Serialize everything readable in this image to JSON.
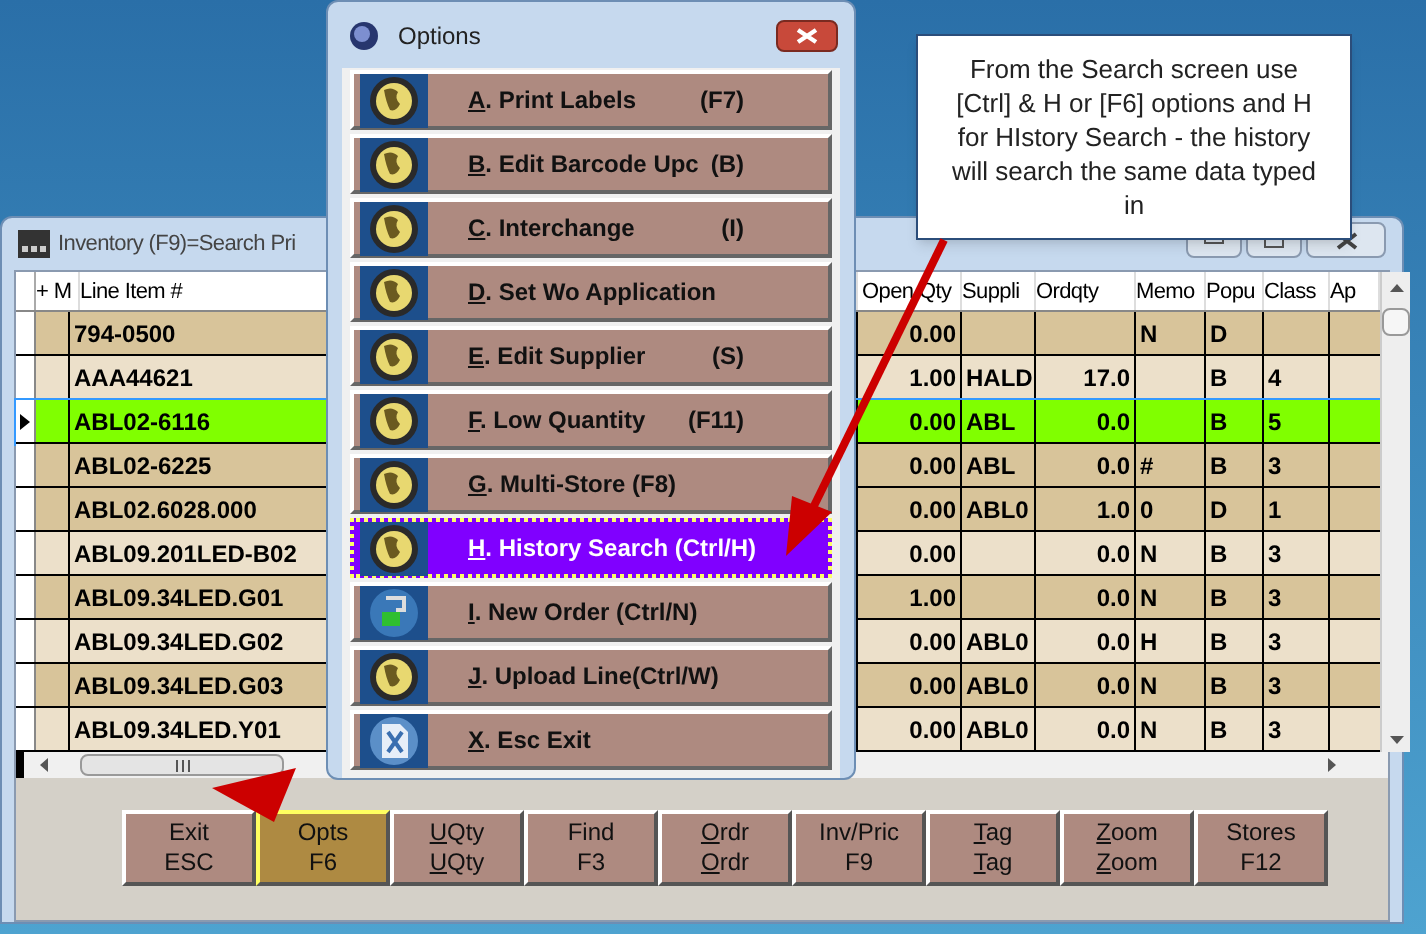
{
  "window": {
    "title": "Inventory (F9)=Search Pri"
  },
  "grid": {
    "columns": [
      "+ M",
      "Line Item #",
      "Open Qty",
      "Suppli",
      "Ordqty",
      "Memo",
      "Popu",
      "Class",
      "Ap"
    ],
    "rows": [
      {
        "item": "794-0500",
        "open_qty": "0.00",
        "supplier": "",
        "ordqty": "",
        "memo": "N",
        "popu": "D",
        "class": "",
        "shaded": true,
        "selected": false
      },
      {
        "item": "AAA44621",
        "open_qty": "1.00",
        "supplier": "HALD",
        "ordqty": "17.0",
        "memo": "",
        "popu": "B",
        "class": "4",
        "shaded": false,
        "selected": false
      },
      {
        "item": "ABL02-6116",
        "open_qty": "0.00",
        "supplier": "ABL",
        "ordqty": "0.0",
        "memo": "",
        "popu": "B",
        "class": "5",
        "selected": true
      },
      {
        "item": "ABL02-6225",
        "open_qty": "0.00",
        "supplier": "ABL",
        "ordqty": "0.0",
        "memo": "#",
        "popu": "B",
        "class": "3",
        "shaded": true,
        "selected": false
      },
      {
        "item": "ABL02.6028.000",
        "open_qty": "0.00",
        "supplier": "ABL0",
        "ordqty": "1.0",
        "memo": "0",
        "popu": "D",
        "class": "1",
        "shaded": true,
        "selected": false
      },
      {
        "item": "ABL09.201LED-B02",
        "open_qty": "0.00",
        "supplier": "",
        "ordqty": "0.0",
        "memo": "N",
        "popu": "B",
        "class": "3",
        "shaded": false,
        "selected": false
      },
      {
        "item": "ABL09.34LED.G01",
        "open_qty": "1.00",
        "supplier": "",
        "ordqty": "0.0",
        "memo": "N",
        "popu": "B",
        "class": "3",
        "shaded": true,
        "selected": false
      },
      {
        "item": "ABL09.34LED.G02",
        "open_qty": "0.00",
        "supplier": "ABL0",
        "ordqty": "0.0",
        "memo": "H",
        "popu": "B",
        "class": "3",
        "shaded": false,
        "selected": false
      },
      {
        "item": "ABL09.34LED.G03",
        "open_qty": "0.00",
        "supplier": "ABL0",
        "ordqty": "0.0",
        "memo": "N",
        "popu": "B",
        "class": "3",
        "shaded": true,
        "selected": false
      },
      {
        "item": "ABL09.34LED.Y01",
        "open_qty": "0.00",
        "supplier": "ABL0",
        "ordqty": "0.0",
        "memo": "N",
        "popu": "B",
        "class": "3",
        "shaded": false,
        "selected": false
      }
    ]
  },
  "buttons": [
    {
      "line1": "Exit",
      "line2": "ESC",
      "mnemonic": false,
      "selected": false
    },
    {
      "line1": "Opts",
      "line2": "F6",
      "mnemonic": false,
      "selected": true
    },
    {
      "line1": "UQty",
      "line2": "UQty",
      "mnemonic": true,
      "selected": false
    },
    {
      "line1": "Find",
      "line2": "F3",
      "mnemonic": false,
      "selected": false
    },
    {
      "line1": "Ordr",
      "line2": "Ordr",
      "mnemonic": true,
      "selected": false
    },
    {
      "line1": "Inv/Pric",
      "line2": "F9",
      "mnemonic": false,
      "selected": false
    },
    {
      "line1": "Tag",
      "line2": "Tag",
      "mnemonic": true,
      "selected": false
    },
    {
      "line1": "Zoom",
      "line2": "Zoom",
      "mnemonic": true,
      "selected": false
    },
    {
      "line1": "Stores",
      "line2": "F12",
      "mnemonic": false,
      "selected": false
    }
  ],
  "dialog": {
    "title": "Options",
    "items": [
      {
        "label": "A. Print Labels",
        "shortcut": "(F7)",
        "kind": "globe",
        "selected": false
      },
      {
        "label": "B. Edit Barcode Upc",
        "shortcut": "(B)",
        "kind": "globe",
        "selected": false
      },
      {
        "label": "C. Interchange",
        "shortcut": "(I)",
        "kind": "globe",
        "selected": false
      },
      {
        "label": "D. Set Wo Application",
        "kind": "globe",
        "selected": false
      },
      {
        "label": "E. Edit Supplier",
        "shortcut": "(S)",
        "kind": "globe",
        "selected": false
      },
      {
        "label": "F. Low Quantity",
        "shortcut": "(F11)",
        "kind": "globe",
        "selected": false
      },
      {
        "label": "G. Multi-Store (F8)",
        "kind": "globe",
        "selected": false
      },
      {
        "label": "H. History Search (Ctrl/H)",
        "kind": "globe",
        "selected": true
      },
      {
        "label": "I. New Order (Ctrl/N)",
        "kind": "order",
        "selected": false
      },
      {
        "label": "J. Upload Line(Ctrl/W)",
        "kind": "globe",
        "selected": false
      },
      {
        "label": "X. Esc  Exit",
        "kind": "document",
        "selected": false
      }
    ]
  },
  "callout": "From the Search screen use [Ctrl] & H or [F6] options and H for HIstory Search - the history will search the same data typed in"
}
